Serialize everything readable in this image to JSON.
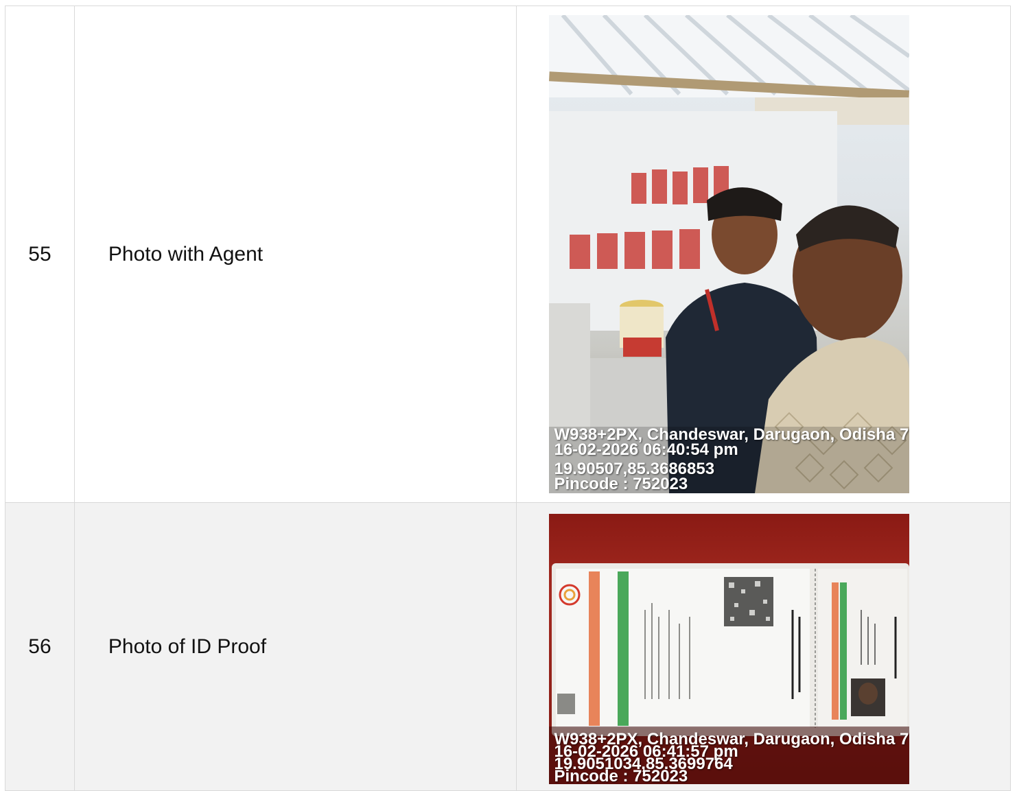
{
  "rows": [
    {
      "number": "55",
      "label": "Photo with Agent",
      "photo": {
        "description_icon": "selfie-photo",
        "overlay": [
          "W938+2PX, Chandeswar, Darugaon, Odisha 7",
          "16-02-2026 06:40:54 pm",
          "19.90507,85.3686853",
          "Pincode : 752023"
        ]
      }
    },
    {
      "number": "56",
      "label": "Photo of ID Proof",
      "photo": {
        "description_icon": "id-card-photo",
        "overlay": [
          "W938+2PX, Chandeswar, Darugaon, Odisha 7",
          "16-02-2026 06:41:57 pm",
          "19.9051034,85.3699764",
          "Pincode : 752023"
        ]
      }
    }
  ],
  "colors": {
    "border": "#d9d9d9",
    "alt_row": "#f2f2f2"
  }
}
